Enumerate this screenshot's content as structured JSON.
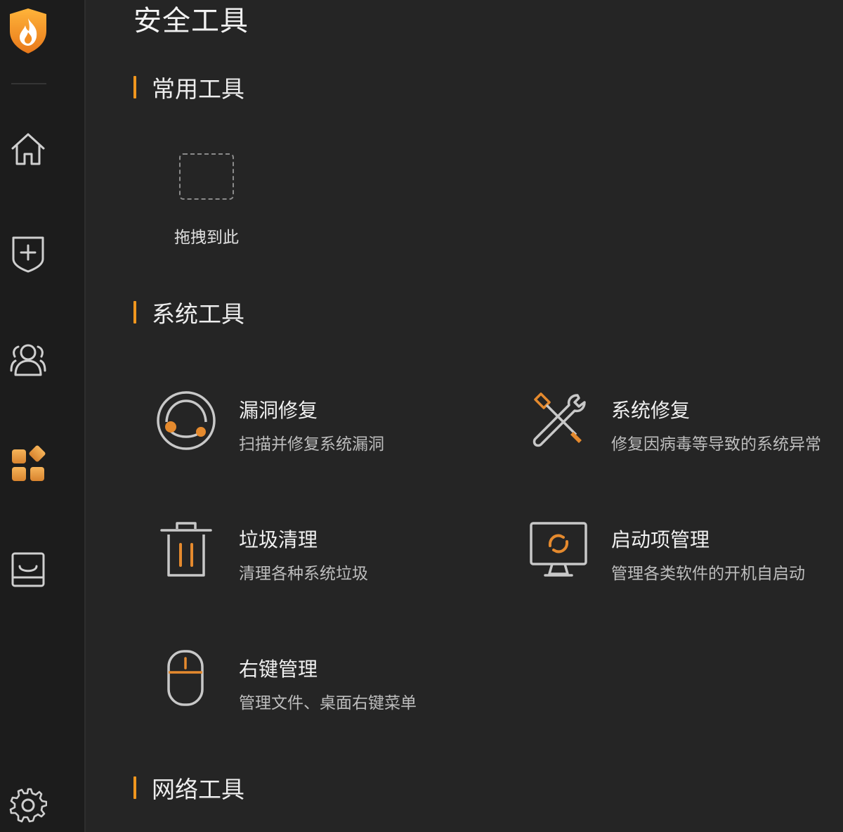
{
  "app": {
    "brand_color": "#f0961e"
  },
  "sidebar": {
    "logo_icon": "flame-shield-logo-icon",
    "items": [
      {
        "icon": "home-icon",
        "active": false
      },
      {
        "icon": "shield-plus-icon",
        "active": false
      },
      {
        "icon": "users-icon",
        "active": false
      },
      {
        "icon": "toolbox-grid-icon",
        "active": true
      },
      {
        "icon": "tray-icon",
        "active": false
      }
    ],
    "settings_icon": "gear-icon"
  },
  "page": {
    "title": "安全工具"
  },
  "sections": {
    "common": {
      "title": "常用工具",
      "drop_label": "拖拽到此"
    },
    "system": {
      "title": "系统工具",
      "tools": [
        {
          "icon": "vulnerability-repair-icon",
          "name": "漏洞修复",
          "desc": "扫描并修复系统漏洞"
        },
        {
          "icon": "wrench-screwdriver-icon",
          "name": "系统修复",
          "desc": "修复因病毒等导致的系统异常"
        },
        {
          "icon": "trash-icon",
          "name": "垃圾清理",
          "desc": "清理各种系统垃圾"
        },
        {
          "icon": "monitor-refresh-icon",
          "name": "启动项管理",
          "desc": "管理各类软件的开机自启动"
        },
        {
          "icon": "mouse-icon",
          "name": "右键管理",
          "desc": "管理文件、桌面右键菜单"
        }
      ]
    },
    "network": {
      "title": "网络工具"
    }
  }
}
